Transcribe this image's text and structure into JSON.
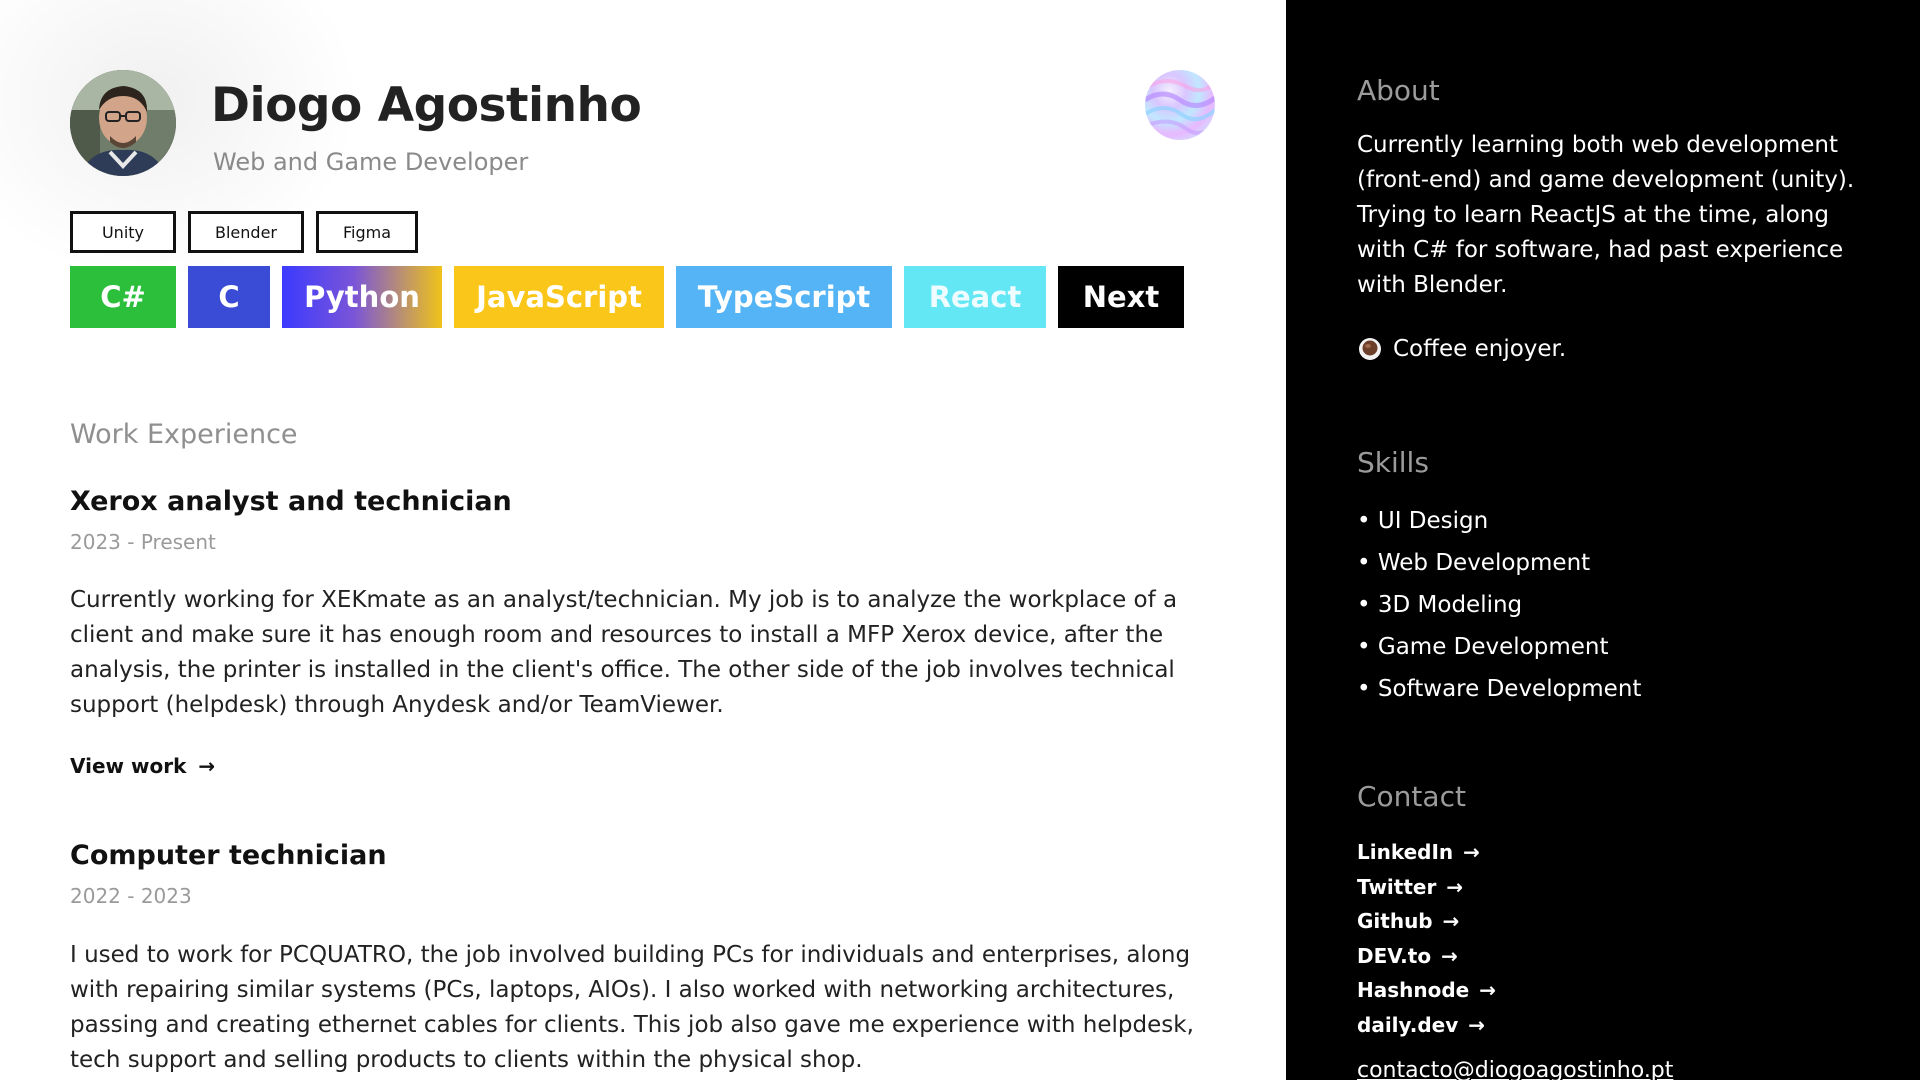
{
  "profile": {
    "name": "Diogo Agostinho",
    "role": "Web and Game Developer"
  },
  "tools": [
    "Unity",
    "Blender",
    "Figma"
  ],
  "languages": [
    {
      "label": "C#",
      "color": "#2cbf3b"
    },
    {
      "label": "C",
      "color": "#3a4bd6"
    },
    {
      "label": "Python",
      "color": "#3b3aff"
    },
    {
      "label": "JavaScript",
      "color": "#fbc61a"
    },
    {
      "label": "TypeScript",
      "color": "#54b4f5"
    },
    {
      "label": "React",
      "color": "#64e7f5"
    },
    {
      "label": "Next",
      "color": "#000000"
    }
  ],
  "work": {
    "section_title": "Work Experience",
    "jobs": [
      {
        "title": "Xerox analyst and technician",
        "dates": "2023 - Present",
        "description": "Currently working for XEKmate as an analyst/technician. My job is to analyze the workplace of a client and make sure it has enough room and resources to install a MFP Xerox device, after the analysis, the printer is installed in the client's office. The other side of the job involves technical support (helpdesk) through Anydesk and/or TeamViewer.",
        "link_label": "View work",
        "link_arrow": "→"
      },
      {
        "title": "Computer technician",
        "dates": "2022 - 2023",
        "description": "I used to work for PCQUATRO, the job involved building PCs for individuals and enterprises, along with repairing similar systems (PCs, laptops, AIOs). I also worked with networking architectures, passing and creating ethernet cables for clients. This job also gave me experience with helpdesk, tech support and selling products to clients within the physical shop."
      }
    ]
  },
  "sidebar": {
    "about_title": "About",
    "about_text": "Currently learning both web development (front-end) and game development (unity). Trying to learn ReactJS at the time, along with C# for software, had past experience with Blender.",
    "coffee_text": "Coffee enjoyer.",
    "skills_title": "Skills",
    "skills": [
      "• UI Design",
      "• Web Development",
      "• 3D Modeling",
      "• Game Development",
      "• Software Development"
    ],
    "contact_title": "Contact",
    "contacts": [
      "LinkedIn",
      "Twitter",
      "Github",
      "DEV.to",
      "Hashnode",
      "daily.dev"
    ],
    "contact_arrow": "→",
    "email": "contacto@diogoagostinho.pt"
  },
  "icons": {
    "avatar": "profile-photo",
    "orb": "holographic-orb-icon",
    "coffee": "coffee-cup-icon",
    "arrow": "arrow-right-icon"
  }
}
